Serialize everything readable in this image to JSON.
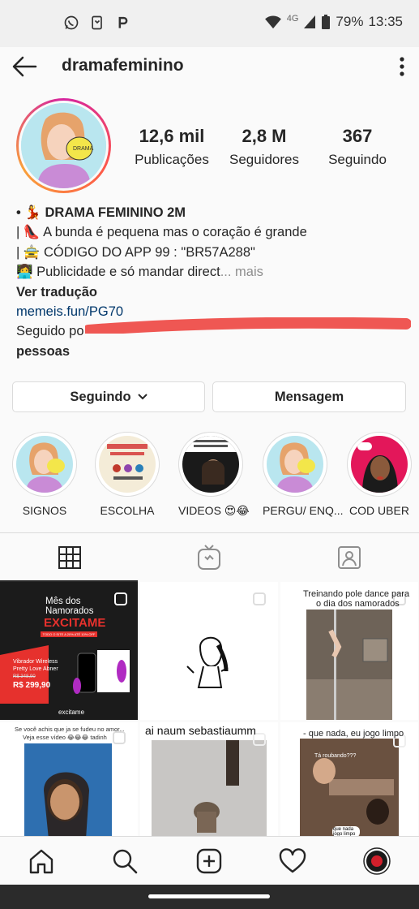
{
  "status_bar": {
    "network": "4G",
    "battery": "79%",
    "time": "13:35",
    "left_icons": [
      "whatsapp-icon",
      "call-log-icon",
      "p-app-icon"
    ]
  },
  "header": {
    "username": "dramafeminino"
  },
  "stats": [
    {
      "num": "12,6 mil",
      "label": "Publicações"
    },
    {
      "num": "2,8 M",
      "label": "Seguidores"
    },
    {
      "num": "367",
      "label": "Seguindo"
    }
  ],
  "bio": {
    "name_line": "• 💃 DRAMA FEMININO 2M",
    "line2": "| 👠 A bunda é pequena mas o coração é grande",
    "line3": "| 🚖 CÓDIGO DO APP 99  : \"BR57A288\"",
    "line4": "👩‍💻 Publicidade e só mandar direct",
    "ellipsis": "...",
    "more": " mais",
    "translate": "Ver tradução",
    "link": "memeis.fun/PG70",
    "followed_by": "Seguido po",
    "people": "pessoas"
  },
  "buttons": {
    "following": "Seguindo",
    "message": "Mensagem"
  },
  "highlights": [
    {
      "label": "SIGNOS"
    },
    {
      "label": "ESCOLHA"
    },
    {
      "label": "VIDEOS 😍😂"
    },
    {
      "label": "PERGU/ ENQ..."
    },
    {
      "label": "COD UBER"
    }
  ],
  "grid": {
    "post1": {
      "title_l1": "Mês dos",
      "title_l2": "Namorados",
      "brand": "EXCITAME",
      "promo": "TODO O SITE A 20% ATÉ 10% OFF",
      "product_l1": "Vibrador Wireless",
      "product_l2": "Pretty Love Abner",
      "old_price": "R$ 348,90",
      "price": "R$ 299,90",
      "logo": "excitame"
    },
    "post3": {
      "caption_l1": "Treinando pole dance para",
      "caption_l2": "o dia dos namorados"
    },
    "post4": {
      "caption_l1": "Se você achis que ja se fudeu no amor...",
      "caption_l2": "Veja esse vídeo 😂😂😂 tadinh"
    },
    "post5": {
      "caption": "ai naum sebastiaumm"
    },
    "post6": {
      "caption": "- que nada, eu jogo limpo",
      "bubble1": "Tá roubando???",
      "bubble2": "que nada jogo limpo"
    }
  },
  "colors": {
    "accent_red": "#ed4956",
    "link": "#00376b",
    "text": "#262626",
    "muted": "#8e8e8e",
    "border": "#dbdbdb"
  }
}
